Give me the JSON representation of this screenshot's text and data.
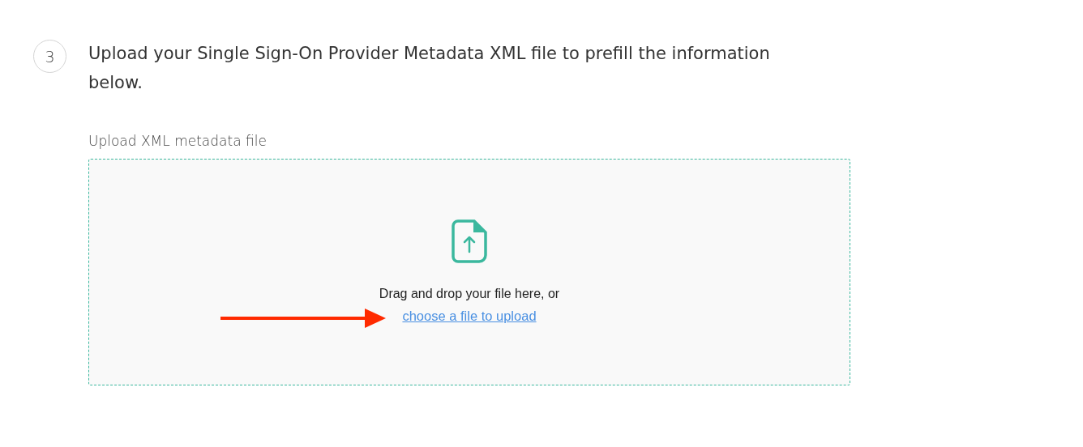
{
  "step": {
    "number": "3",
    "heading": "Upload your Single Sign-On Provider Metadata XML file to prefill the information below."
  },
  "upload": {
    "label": "Upload XML metadata file",
    "prompt": "Drag and drop your file here, or",
    "link": "choose a file to upload"
  },
  "annotation": {
    "kind": "arrow"
  }
}
